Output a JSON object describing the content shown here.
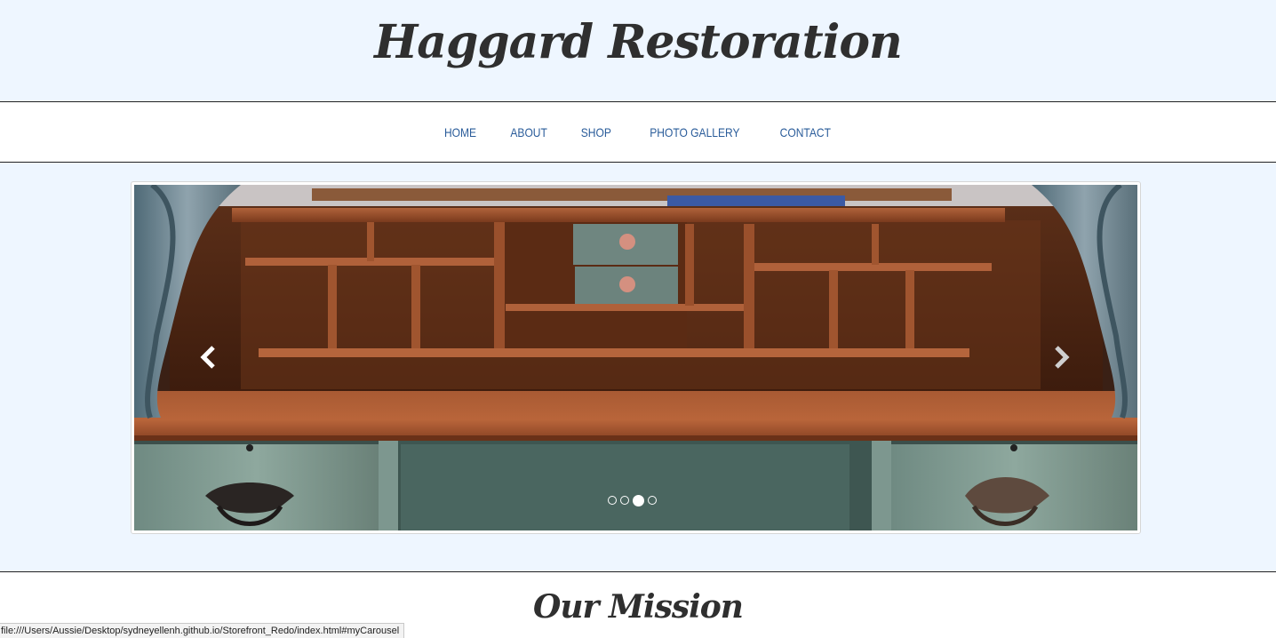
{
  "header": {
    "brand_title": "Haggard Restoration"
  },
  "nav": {
    "items": [
      {
        "label": "HOME"
      },
      {
        "label": "ABOUT"
      },
      {
        "label": "SHOP"
      },
      {
        "label": "PHOTO GALLERY"
      },
      {
        "label": "CONTACT"
      }
    ],
    "link_color": "#2a5c9a"
  },
  "carousel": {
    "prev_icon": "chevron-left-icon",
    "next_icon": "chevron-right-icon",
    "slide_count": 4,
    "active_index": 2
  },
  "mission": {
    "title": "Our Mission"
  },
  "status_bar": {
    "url": "file:///Users/Aussie/Desktop/sydneyellenh.github.io/Storefront_Redo/index.html#myCarousel"
  },
  "colors": {
    "page_background": "#eef6ff",
    "text_dark": "#2f2f2f"
  }
}
